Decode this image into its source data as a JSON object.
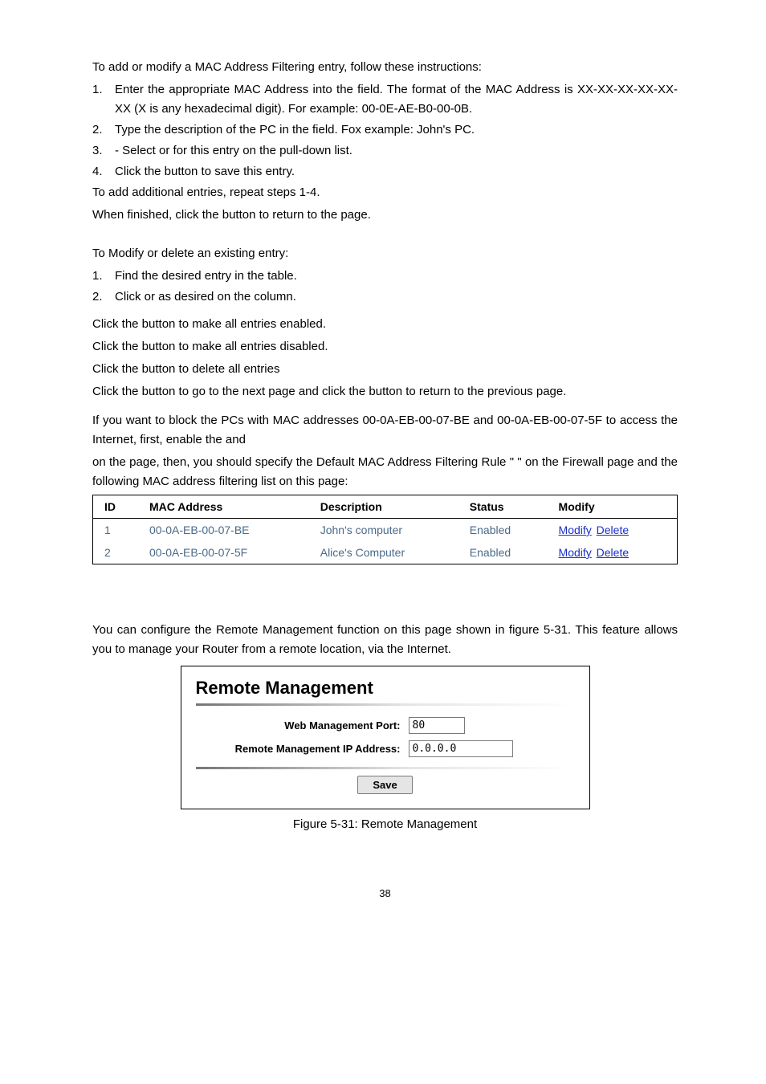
{
  "intro_add_modify": "To add or modify a MAC Address Filtering entry, follow these instructions:",
  "steps_a": {
    "n1": "1.",
    "t1": "Enter the appropriate MAC Address into the                       field. The format of the MAC Address is XX-XX-XX-XX-XX-XX (X is any hexadecimal digit). For example: 00-0E-AE-B0-00-0B.",
    "n2": "2.",
    "t2": "Type the description of the PC in the                   field. Fox example: John's PC.",
    "n3": "3.",
    "t3": "          - Select              or              for this entry on the            pull-down list.",
    "n4": "4.",
    "t4": "Click the           button to save this entry."
  },
  "after_a1": "To add additional entries, repeat steps 1-4.",
  "after_a2": "When finished, click the            button to return to the                                         page.",
  "intro_modify_delete": "To Modify or delete an existing entry:",
  "steps_b": {
    "n1": "1.",
    "t1": "Find the desired entry in the table.",
    "n2": "2.",
    "t2": "Click           or           as desired on the           column."
  },
  "click_lines": {
    "l1": "Click the                  button to make all entries enabled.",
    "l2": "Click the                   button to make all entries disabled.",
    "l3": "Click the               button to delete all entries",
    "l4": "Click the         button to go to the next page and click the               button to return to the previous page."
  },
  "example_block": {
    "l1": "                     If you want to block the PCs with MAC addresses 00-0A-EB-00-07-BE and 00-0A-EB-00-07-5F to access the Internet, first, enable the               and",
    "l2": "                            on the               page, then, you should specify the Default MAC Address Filtering Rule \"                                                                                                         \" on the Firewall page and the following MAC address filtering list on this page:"
  },
  "table": {
    "headers": {
      "id": "ID",
      "mac": "MAC Address",
      "desc": "Description",
      "status": "Status",
      "mod": "Modify"
    },
    "rows": [
      {
        "id": "1",
        "mac": "00-0A-EB-00-07-BE",
        "desc": "John's computer",
        "status": "Enabled",
        "modify": "Modify",
        "delete": "Delete"
      },
      {
        "id": "2",
        "mac": "00-0A-EB-00-07-5F",
        "desc": "Alice's Computer",
        "status": "Enabled",
        "modify": "Modify",
        "delete": "Delete"
      }
    ]
  },
  "rm_intro": "You can configure the Remote Management function on this page shown in figure 5-31. This feature allows you to manage your Router from a remote location, via the Internet.",
  "rm": {
    "title": "Remote Management",
    "port_label": "Web Management Port:",
    "port_value": "80",
    "ip_label": "Remote Management IP Address:",
    "ip_value": "0.0.0.0",
    "save": "Save"
  },
  "figure_caption": "Figure 5-31: Remote Management",
  "page_number": "38"
}
